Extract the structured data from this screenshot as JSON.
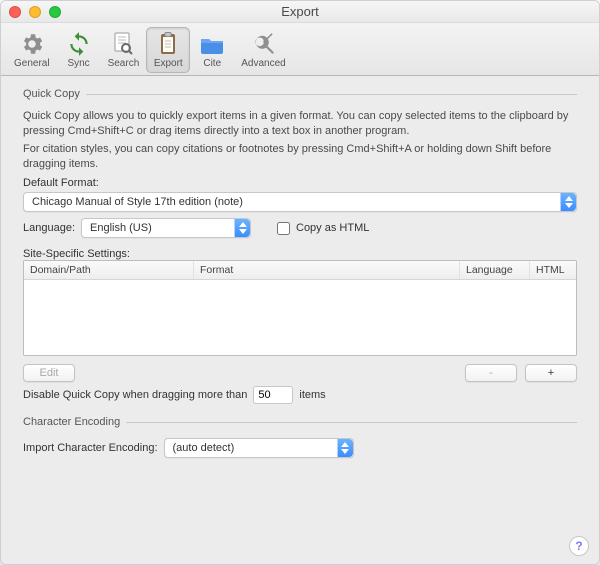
{
  "window": {
    "title": "Export"
  },
  "toolbar": {
    "items": [
      {
        "key": "general",
        "label": "General"
      },
      {
        "key": "sync",
        "label": "Sync"
      },
      {
        "key": "search",
        "label": "Search"
      },
      {
        "key": "export",
        "label": "Export"
      },
      {
        "key": "cite",
        "label": "Cite"
      },
      {
        "key": "advanced",
        "label": "Advanced"
      }
    ],
    "selected": "export"
  },
  "quickcopy": {
    "legend": "Quick Copy",
    "desc1": "Quick Copy allows you to quickly export items in a given format. You can copy selected items to the clipboard by pressing Cmd+Shift+C or drag items directly into a text box in another program.",
    "desc2": "For citation styles, you can copy citations or footnotes by pressing Cmd+Shift+A or holding down Shift before dragging items.",
    "default_format_label": "Default Format:",
    "default_format_value": "Chicago Manual of Style 17th edition (note)",
    "language_label": "Language:",
    "language_value": "English (US)",
    "copy_html_label": "Copy as HTML",
    "site_settings_label": "Site-Specific Settings:",
    "site_columns": {
      "domain": "Domain/Path",
      "format": "Format",
      "language": "Language",
      "html": "HTML"
    },
    "edit_btn": "Edit",
    "minus_btn": "-",
    "plus_btn": "+",
    "disable_prefix": "Disable Quick Copy when dragging more than",
    "disable_value": "50",
    "disable_suffix": "items"
  },
  "encoding": {
    "legend": "Character Encoding",
    "label": "Import Character Encoding:",
    "value": "(auto detect)"
  }
}
